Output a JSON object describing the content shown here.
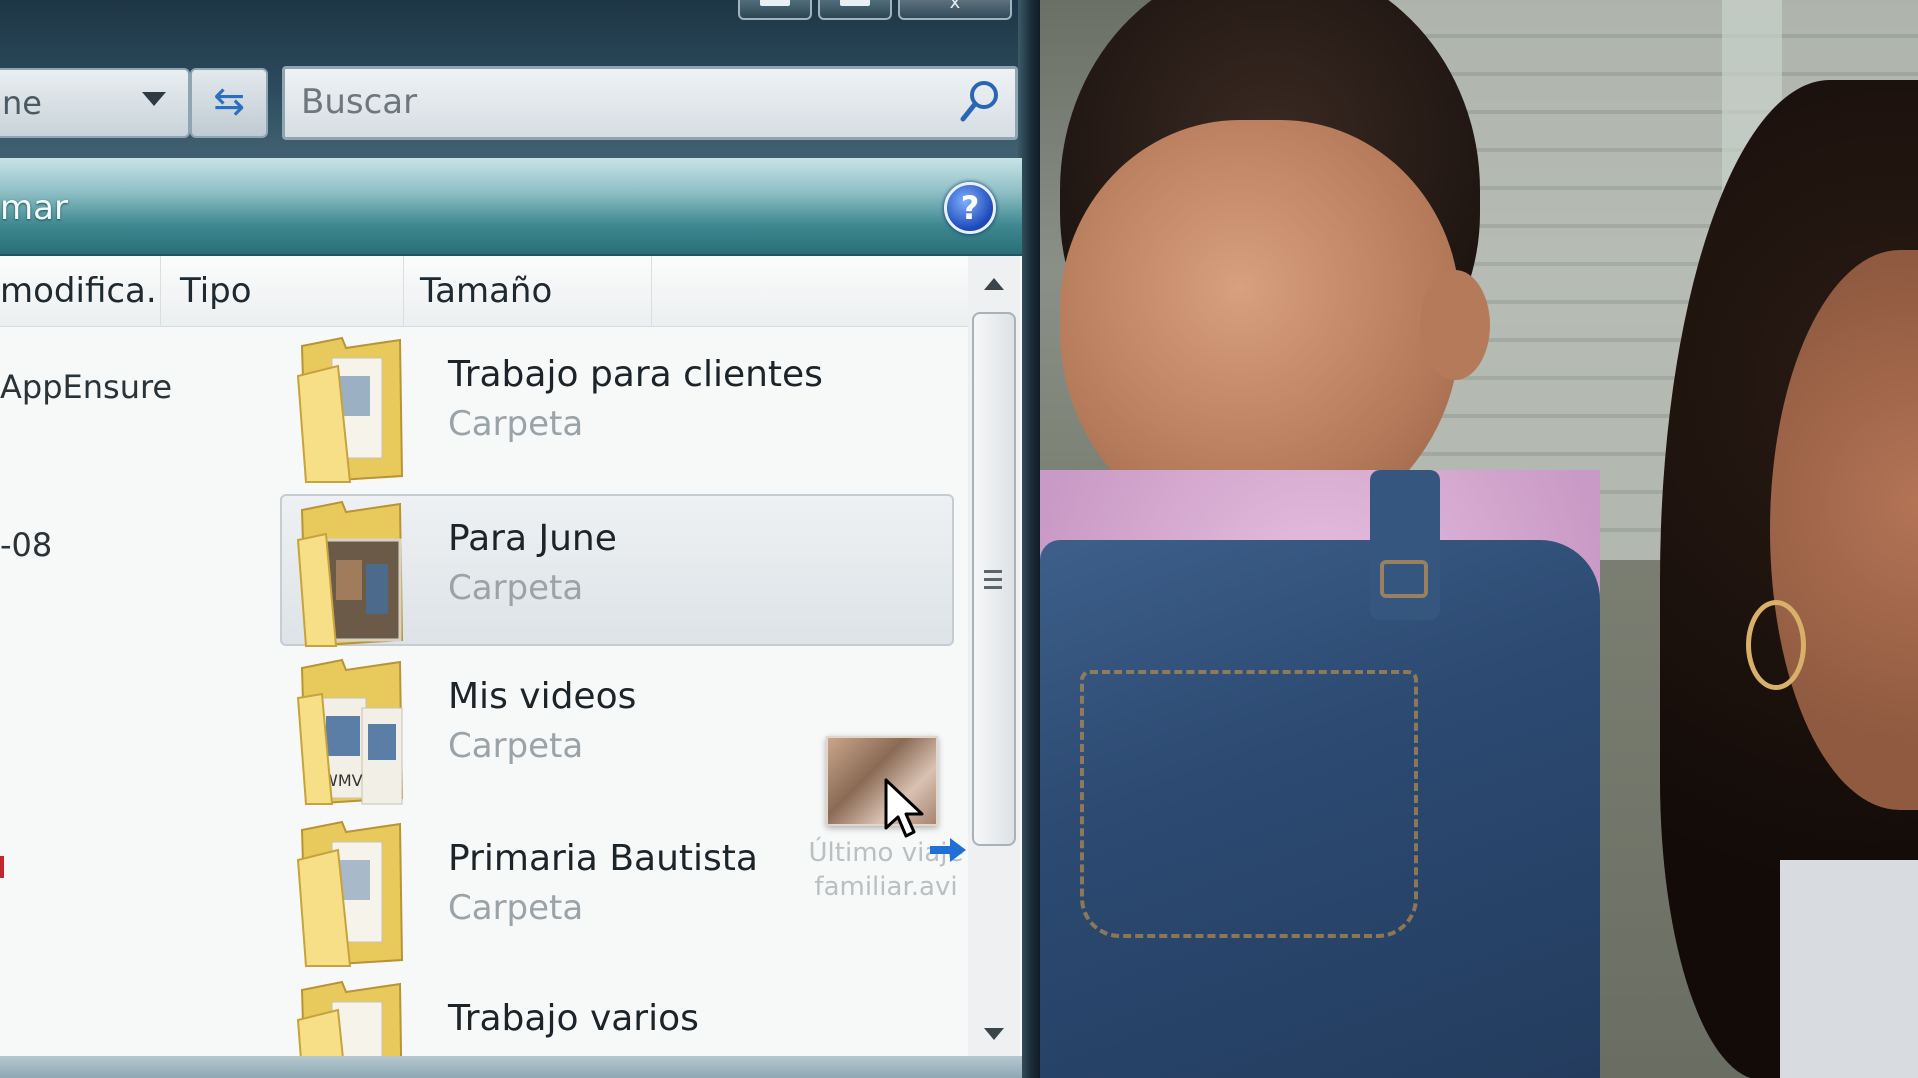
{
  "window": {
    "caption_buttons": {
      "minimize": "",
      "maximize": "",
      "close": "x"
    },
    "address": {
      "text": "ne"
    },
    "search": {
      "placeholder": "Buscar"
    },
    "toolbar": {
      "label": "mar"
    }
  },
  "columns": {
    "modified": "modifica...",
    "type": "Tipo",
    "size": "Tamaño"
  },
  "left_values": [
    "AppEnsure",
    "-08"
  ],
  "items": [
    {
      "name": "Trabajo para clientes",
      "type": "Carpeta"
    },
    {
      "name": "Para June",
      "type": "Carpeta"
    },
    {
      "name": "Mis videos",
      "type": "Carpeta"
    },
    {
      "name": "Primaria Bautista",
      "type": "Carpeta"
    },
    {
      "name": "Trabajo varios",
      "type": ""
    }
  ],
  "drag": {
    "caption_line1": "Último viaje",
    "caption_line2": "familiar.avi"
  },
  "colors": {
    "toolbar_teal": "#3e8890",
    "help_blue": "#1c48b8",
    "folder_yellow": "#f1d774",
    "selection_bg": "#dde3e7"
  },
  "icons": {
    "search": "magnifier",
    "help": "question-mark",
    "refresh": "refresh-arrows",
    "folder": "folder",
    "cursor": "arrow-pointer",
    "move": "right-arrow"
  }
}
